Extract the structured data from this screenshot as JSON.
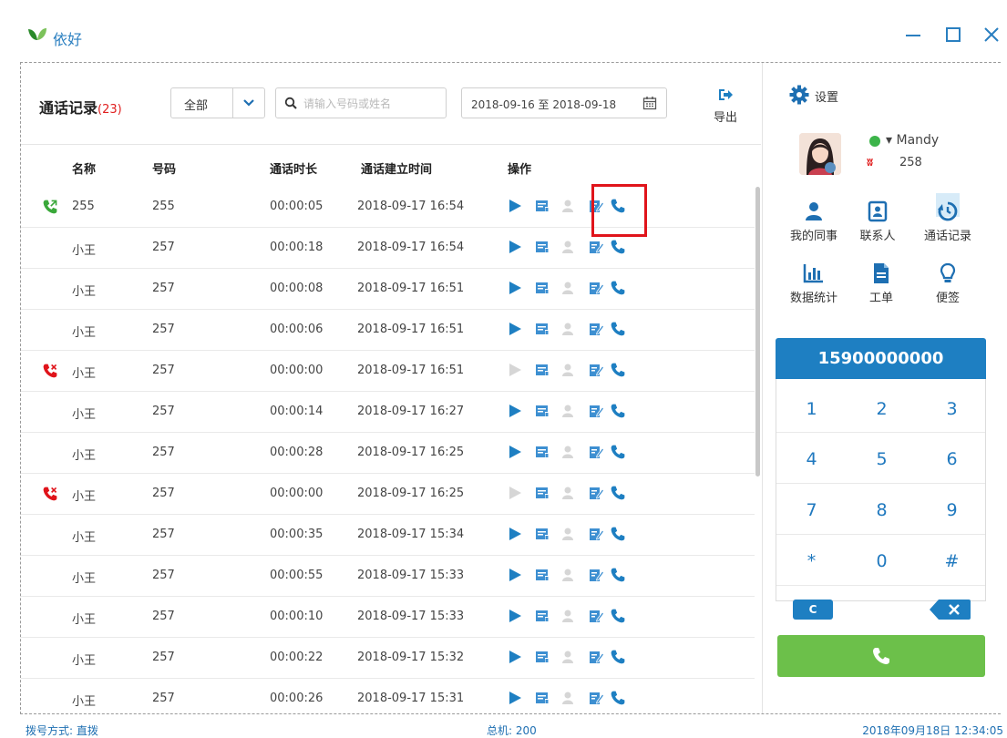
{
  "app": {
    "title": "依好"
  },
  "window": {
    "minimize": "minimize-icon",
    "maximize": "maximize-icon",
    "close": "close-icon"
  },
  "toolbar": {
    "title": "通话记录",
    "count": "(23)",
    "filter_value": "全部",
    "search_placeholder": "请输入号码或姓名",
    "date_range": "2018-09-16 至 2018-09-18",
    "export_label": "导出"
  },
  "table": {
    "columns": [
      "名称",
      "号码",
      "通话时长",
      "通话建立时间",
      "操作"
    ],
    "rows": [
      {
        "name": "255",
        "number": "255",
        "duration": "00:00:05",
        "time": "2018-09-17 16:54",
        "direction": "outgoing",
        "play_enabled": true
      },
      {
        "name": "小王",
        "number": "257",
        "duration": "00:00:18",
        "time": "2018-09-17 16:54",
        "direction": "",
        "play_enabled": true
      },
      {
        "name": "小王",
        "number": "257",
        "duration": "00:00:08",
        "time": "2018-09-17 16:51",
        "direction": "",
        "play_enabled": true
      },
      {
        "name": "小王",
        "number": "257",
        "duration": "00:00:06",
        "time": "2018-09-17 16:51",
        "direction": "",
        "play_enabled": true
      },
      {
        "name": "小王",
        "number": "257",
        "duration": "00:00:00",
        "time": "2018-09-17 16:51",
        "direction": "missed",
        "play_enabled": false
      },
      {
        "name": "小王",
        "number": "257",
        "duration": "00:00:14",
        "time": "2018-09-17 16:27",
        "direction": "",
        "play_enabled": true
      },
      {
        "name": "小王",
        "number": "257",
        "duration": "00:00:28",
        "time": "2018-09-17 16:25",
        "direction": "",
        "play_enabled": true
      },
      {
        "name": "小王",
        "number": "257",
        "duration": "00:00:00",
        "time": "2018-09-17 16:25",
        "direction": "missed",
        "play_enabled": false
      },
      {
        "name": "小王",
        "number": "257",
        "duration": "00:00:35",
        "time": "2018-09-17 15:34",
        "direction": "",
        "play_enabled": true
      },
      {
        "name": "小王",
        "number": "257",
        "duration": "00:00:55",
        "time": "2018-09-17 15:33",
        "direction": "",
        "play_enabled": true
      },
      {
        "name": "小王",
        "number": "257",
        "duration": "00:00:10",
        "time": "2018-09-17 15:33",
        "direction": "",
        "play_enabled": true
      },
      {
        "name": "小王",
        "number": "257",
        "duration": "00:00:22",
        "time": "2018-09-17 15:32",
        "direction": "",
        "play_enabled": true
      },
      {
        "name": "小王",
        "number": "257",
        "duration": "00:00:26",
        "time": "2018-09-17 15:31",
        "direction": "",
        "play_enabled": true
      }
    ]
  },
  "sidebar": {
    "settings_label": "设置",
    "user_name": "Mandy",
    "extension": "258",
    "tools": [
      {
        "label": "我的同事",
        "icon": "colleague-icon"
      },
      {
        "label": "联系人",
        "icon": "contacts-icon"
      },
      {
        "label": "通话记录",
        "icon": "call-history-icon"
      },
      {
        "label": "数据统计",
        "icon": "statistics-icon"
      },
      {
        "label": "工单",
        "icon": "ticket-icon"
      },
      {
        "label": "便签",
        "icon": "note-icon"
      }
    ]
  },
  "dialer": {
    "display": "15900000000",
    "keys": [
      "1",
      "2",
      "3",
      "4",
      "5",
      "6",
      "7",
      "8",
      "9",
      "*",
      "0",
      "#"
    ],
    "clear_label": "C"
  },
  "statusbar": {
    "dial_mode": "拨号方式: 直拨",
    "total": "总机: 200",
    "datetime": "2018年09月18日 12:34:05"
  },
  "colors": {
    "accent": "#1e7fc2",
    "call_green": "#6cc04a",
    "missed_red": "#e0141b",
    "highlight": "#e0141b"
  }
}
